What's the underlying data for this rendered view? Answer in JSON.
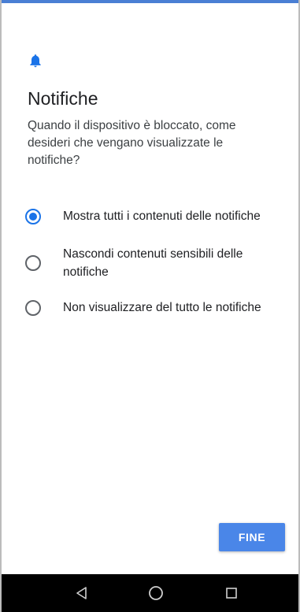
{
  "colors": {
    "accent": "#1a73e8",
    "button_bg": "#4a86e8",
    "navbar_bg": "#000000",
    "status_strip": "#4a7fd4"
  },
  "header": {
    "icon": "bell-icon",
    "title": "Notifiche",
    "subtitle": "Quando il dispositivo è bloccato, come desideri che vengano visualizzate le notifiche?"
  },
  "options": [
    {
      "label": "Mostra tutti i contenuti delle notifiche",
      "selected": true
    },
    {
      "label": "Nascondi contenuti sensibili delle notifiche",
      "selected": false
    },
    {
      "label": "Non visualizzare del tutto le notifiche",
      "selected": false
    }
  ],
  "actions": {
    "done_label": "FINE"
  },
  "navbar": {
    "icons": [
      "back-triangle-icon",
      "home-circle-icon",
      "recents-square-icon"
    ]
  }
}
